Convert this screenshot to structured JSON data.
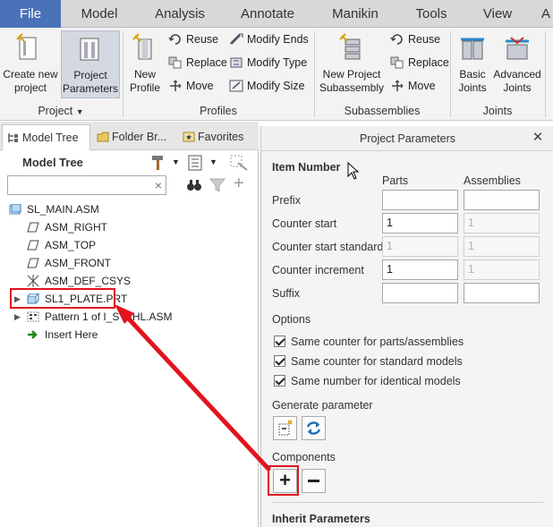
{
  "menu": {
    "tabs": [
      "File",
      "Model",
      "Analysis",
      "Annotate",
      "Manikin",
      "Tools",
      "View",
      "A"
    ]
  },
  "ribbon": {
    "project_group": {
      "create_new_project": [
        "Create new",
        "project"
      ],
      "project_parameters": [
        "Project",
        "Parameters"
      ],
      "label": "Project"
    },
    "profiles_group": {
      "new_profile": [
        "New",
        "Profile"
      ],
      "reuse": "Reuse",
      "replace": "Replace",
      "move": "Move",
      "modify_ends": "Modify Ends",
      "modify_type": "Modify Type",
      "modify_size": "Modify Size",
      "label": "Profiles"
    },
    "subassemblies_group": {
      "new_project_subassembly": [
        "New Project",
        "Subassembly"
      ],
      "reuse": "Reuse",
      "replace": "Replace",
      "move": "Move",
      "label": "Subassemblies"
    },
    "joints_group": {
      "basic_joints": [
        "Basic",
        "Joints"
      ],
      "advanced_joints": [
        "Advanced",
        "Joints"
      ],
      "label": "Joints"
    }
  },
  "left_panel": {
    "tabs": [
      "Model Tree",
      "Folder Br...",
      "Favorites"
    ],
    "title": "Model Tree",
    "tree": [
      {
        "label": "SL_MAIN.ASM"
      },
      {
        "label": "ASM_RIGHT"
      },
      {
        "label": "ASM_TOP"
      },
      {
        "label": "ASM_FRONT"
      },
      {
        "label": "ASM_DEF_CSYS"
      },
      {
        "label": "SL1_PLATE.PRT"
      },
      {
        "label": "Pattern 1 of I_STAHL.ASM"
      },
      {
        "label": "Insert Here"
      }
    ]
  },
  "dialog": {
    "title": "Project Parameters",
    "item_number": "Item Number",
    "col_parts": "Parts",
    "col_assemblies": "Assemblies",
    "rows": [
      {
        "label": "Prefix",
        "parts": "",
        "assemblies": ""
      },
      {
        "label": "Counter start",
        "parts": "1",
        "assemblies": "1"
      },
      {
        "label": "Counter start standard",
        "parts": "1",
        "assemblies": "1"
      },
      {
        "label": "Counter increment",
        "parts": "1",
        "assemblies": "1"
      },
      {
        "label": "Suffix",
        "parts": "",
        "assemblies": ""
      }
    ],
    "options_label": "Options",
    "options": [
      "Same counter for parts/assemblies",
      "Same counter for standard models",
      "Same number for identical models"
    ],
    "generate_parameter": "Generate parameter",
    "components": "Components",
    "inherit_parameters": "Inherit Parameters"
  },
  "colors": {
    "file_tab": "#4a72b8",
    "callout": "#e0141e",
    "insert_here": "#1a8a1a"
  }
}
